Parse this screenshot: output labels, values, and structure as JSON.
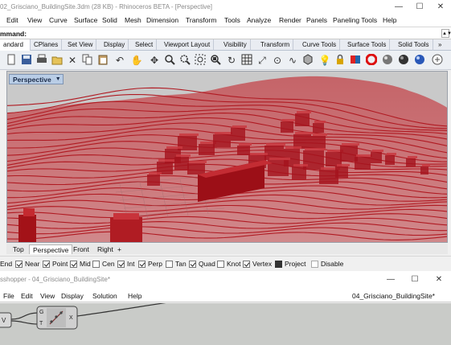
{
  "rhino_window": {
    "title": "02_Grisciano_BuildingSite.3dm (28 KB) - Rhinoceros BETA - [Perspective]",
    "controls": [
      "—",
      "☐",
      "✕"
    ]
  },
  "rhino_menu": [
    "Edit",
    "View",
    "Curve",
    "Surface",
    "Solid",
    "Mesh",
    "Dimension",
    "Transform",
    "Tools",
    "Analyze",
    "Render",
    "Panels",
    "Paneling Tools",
    "Help"
  ],
  "command": {
    "label": "mmand:",
    "value": ""
  },
  "toolbar_tabs": [
    "andard",
    "CPlanes",
    "Set View",
    "Display",
    "Select",
    "Viewport Layout",
    "Visibility",
    "Transform",
    "Curve Tools",
    "Surface Tools",
    "Solid Tools",
    "»"
  ],
  "toolbar_icons": [
    "new-icon",
    "save-icon",
    "print-icon",
    "open-icon",
    "cut-icon",
    "copy-icon",
    "paste-icon",
    "undo-icon",
    "pan-icon",
    "move-icon",
    "zoom-icon",
    "zoom-window-icon",
    "zoom-extents-icon",
    "rotate-icon",
    "zoom-selected-icon",
    "grid-icon",
    "cplane-icon",
    "point-icon",
    "curve-icon",
    "box-icon",
    "lock-icon",
    "color-icon",
    "render-sphere-icon",
    "material-icon",
    "environment-icon",
    "light-icon",
    "settings-icon"
  ],
  "viewport": {
    "label": "Perspective",
    "colors": {
      "background": "#c9c9c9",
      "terrain": "#c0393d",
      "contour": "#b01a22",
      "building": "#a5141d"
    }
  },
  "viewport_tabs": [
    "Top",
    "Perspective",
    "Front",
    "Right",
    "+"
  ],
  "osnap": [
    {
      "label": "End",
      "checked": true
    },
    {
      "label": "Near",
      "checked": true
    },
    {
      "label": "Point",
      "checked": true
    },
    {
      "label": "Mid",
      "checked": true
    },
    {
      "label": "Cen",
      "checked": false
    },
    {
      "label": "Int",
      "checked": true
    },
    {
      "label": "Perp",
      "checked": true
    },
    {
      "label": "Tan",
      "checked": false
    },
    {
      "label": "Quad",
      "checked": true
    },
    {
      "label": "Knot",
      "checked": false
    },
    {
      "label": "Vertex",
      "checked": true
    },
    {
      "label": "Project",
      "checked": true
    },
    {
      "label": "Disable",
      "checked": false
    }
  ],
  "grasshopper_window": {
    "title": "sshopper - 04_Grisciano_BuildingSite*",
    "controls": [
      "—",
      "☐",
      "✕"
    ]
  },
  "grasshopper_menu": [
    "File",
    "Edit",
    "View",
    "Display",
    "Solution",
    "Help"
  ],
  "grasshopper_document": "04_Grisciano_BuildingSite*",
  "grasshopper_nodes": {
    "input_a": "G",
    "input_b": "T",
    "output": "X",
    "left_port": "V"
  }
}
